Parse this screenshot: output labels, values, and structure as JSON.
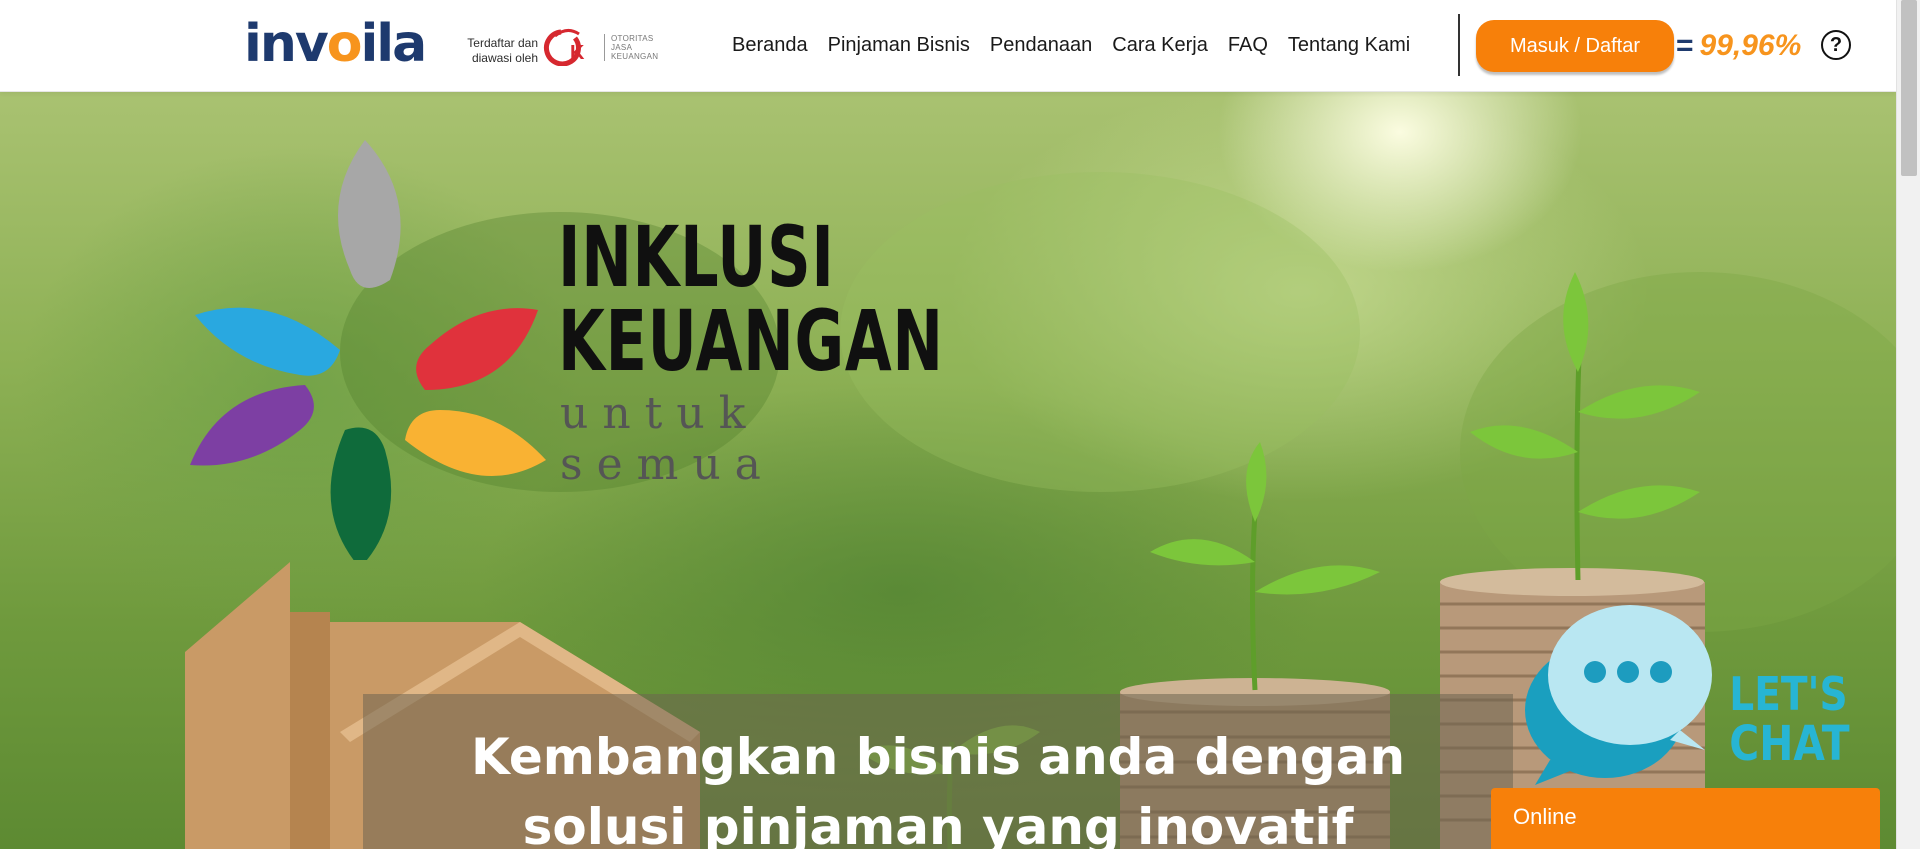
{
  "header": {
    "logo": {
      "text_part1": "inv",
      "text_part2": "o",
      "text_part3": "ila"
    },
    "ojk": {
      "registered_line1": "Terdaftar dan",
      "registered_line2": "diawasi oleh",
      "mark": "OJK",
      "name_line1": "OTORITAS",
      "name_line2": "JASA",
      "name_line3": "KEUANGAN"
    },
    "nav": [
      "Beranda",
      "Pinjaman Bisnis",
      "Pendanaan",
      "Cara Kerja",
      "FAQ",
      "Tentang Kami"
    ],
    "login_label": "Masuk / Daftar",
    "rate_equals": "=",
    "rate_value": "99,96%",
    "help_symbol": "?"
  },
  "hero": {
    "inklusi_line1": "INKLUSI",
    "inklusi_line2": "KEUANGAN",
    "inklusi_line3": "untuk semua",
    "slogan_line1": "Kembangkan bisnis anda dengan",
    "slogan_line2": "solusi pinjaman yang inovatif"
  },
  "chat": {
    "lets_label": "LET'S",
    "chat_label": "CHAT",
    "status_label": "Online"
  },
  "colors": {
    "brand_navy": "#1e3a6e",
    "brand_orange": "#f7941d",
    "button_orange": "#f7800a",
    "chat_cyan": "#27b5d4"
  },
  "icons": [
    "help-icon",
    "chat-bubble-icon",
    "inklusi-flower-logo",
    "ojk-logo"
  ]
}
